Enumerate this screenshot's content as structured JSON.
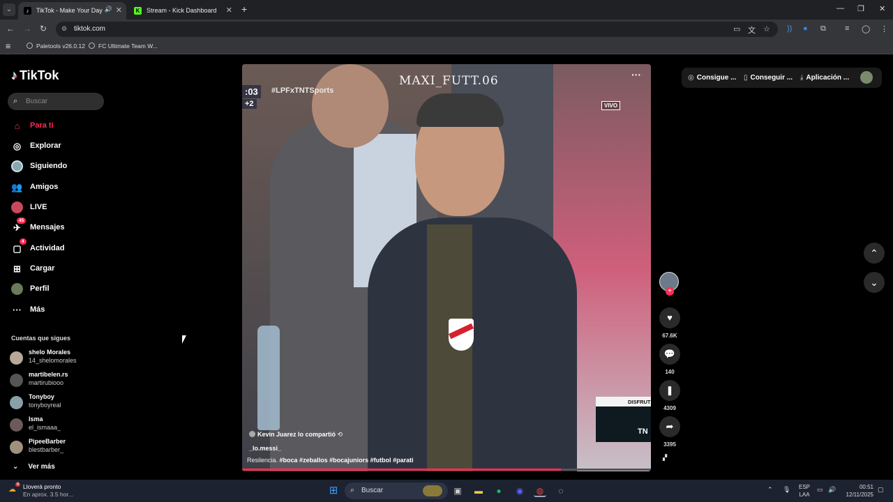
{
  "browser": {
    "tabs": [
      {
        "title": "TikTok - Make Your Day",
        "favicon": "tiktok-icon",
        "active": true
      },
      {
        "title": "Stream - Kick Dashboard",
        "favicon": "kick-icon",
        "active": false
      }
    ],
    "url": "tiktok.com",
    "bookmarks": [
      "Paletools v26.0.12",
      "FC Ultimate Team W..."
    ]
  },
  "tiktok": {
    "logo": "TikTok",
    "search_placeholder": "Buscar",
    "nav": [
      {
        "label": "Para ti",
        "icon": "home-icon",
        "active": true
      },
      {
        "label": "Explorar",
        "icon": "compass-icon"
      },
      {
        "label": "Siguiendo",
        "icon": "following-avatar-icon"
      },
      {
        "label": "Amigos",
        "icon": "friends-icon"
      },
      {
        "label": "LIVE",
        "icon": "live-icon"
      },
      {
        "label": "Mensajes",
        "icon": "messages-icon",
        "badge": "45"
      },
      {
        "label": "Actividad",
        "icon": "activity-icon",
        "badge": "4"
      },
      {
        "label": "Cargar",
        "icon": "upload-icon"
      },
      {
        "label": "Perfil",
        "icon": "profile-icon"
      },
      {
        "label": "Más",
        "icon": "more-icon"
      }
    ],
    "following_title": "Cuentas que sigues",
    "following": [
      {
        "name": "shelo Morales",
        "handle": "14_shelomorales"
      },
      {
        "name": "martibelen.rs",
        "handle": "martirubiooo"
      },
      {
        "name": "Tonyboy",
        "handle": "tonyboyreal"
      },
      {
        "name": "Isma",
        "handle": "el_ismaaa_"
      },
      {
        "name": "PipeeBarber",
        "handle": "blestbarber_"
      }
    ],
    "ver_mas": "Ver más",
    "top_right": {
      "coins": "Consigue ...",
      "get": "Conseguir ...",
      "app": "Aplicación ..."
    },
    "video": {
      "watermark": "MAXI_FUTT.06",
      "scoreboard_time": ":03",
      "scoreboard_score": "+2",
      "hashtag_overlay": "#LPFxTNTSports",
      "live_badge": "VIVO",
      "promo_top": "DISFRUT",
      "promo_bottom": "TN",
      "shared_by": "Kevin Juarez lo compartió",
      "author": "_lo.messi_",
      "caption_text": "Resilencia.",
      "hashtags": "#boca #zeballos #bocajuniors #futbol #parati",
      "progress": 0.78
    },
    "actions": {
      "likes": "67.6K",
      "comments": "140",
      "saves": "4309",
      "shares": "3395"
    }
  },
  "taskbar": {
    "weather_title": "Lloverá pronto",
    "weather_sub": "En aprox. 3.5 hor...",
    "weather_badge": "6",
    "search": "Buscar",
    "lang_top": "ESP",
    "lang_bottom": "LAA",
    "time": "00:51",
    "date": "12/11/2025"
  }
}
